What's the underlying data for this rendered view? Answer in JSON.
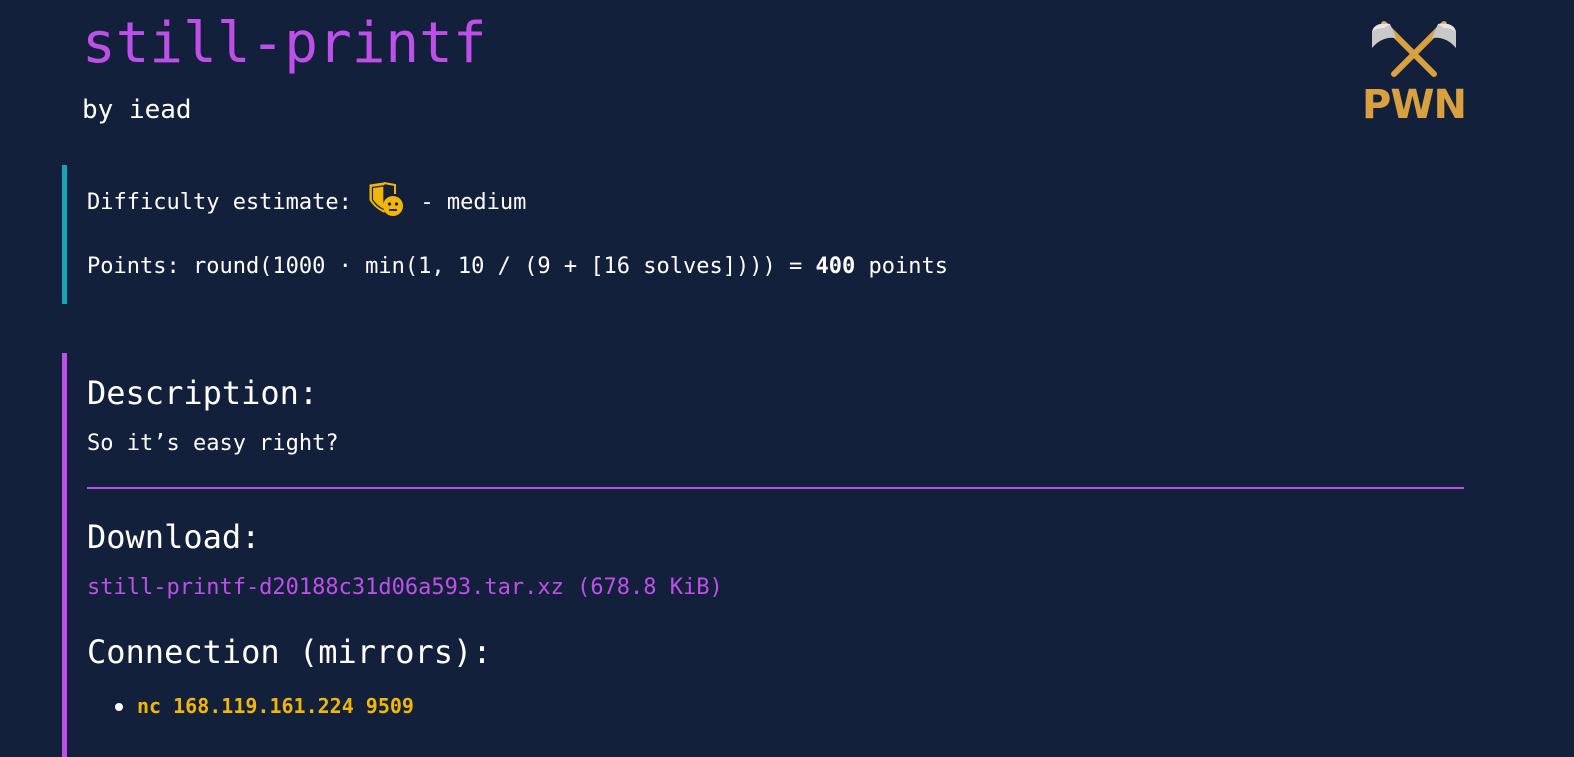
{
  "challenge": {
    "title": "still-printf",
    "author": "by iead",
    "category": "PWN"
  },
  "difficulty": {
    "label": "Difficulty estimate:",
    "level": "- medium",
    "icon": "shield-neutral-face-icon"
  },
  "points": {
    "formula": "Points: round(1000 · min(1, 10 / (9 + [16 solves]))) =",
    "value": "400",
    "unit": "points"
  },
  "description": {
    "heading": "Description:",
    "text": "So it’s easy right?"
  },
  "download": {
    "heading": "Download:",
    "link_text": "still-printf-d20188c31d06a593.tar.xz (678.8 KiB)"
  },
  "connection": {
    "heading": "Connection (mirrors):",
    "mirrors": [
      {
        "command": "nc 168.119.161.224 9509"
      }
    ]
  },
  "colors": {
    "background": "#13203c",
    "accent_purple": "#bf4fe9",
    "accent_teal": "#19a3b8",
    "accent_gold": "#d9a03f",
    "connection_yellow": "#f2b705"
  }
}
